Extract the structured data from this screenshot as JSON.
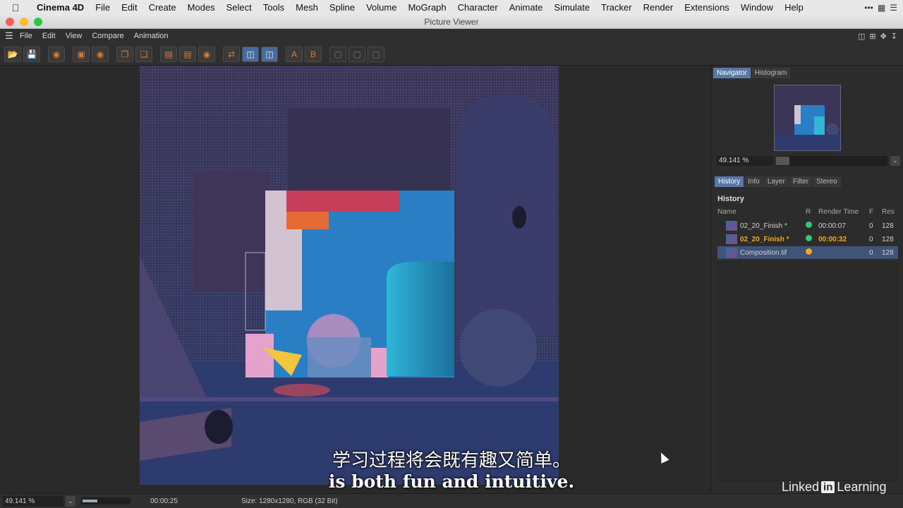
{
  "mac_menu": {
    "app": "Cinema 4D",
    "items": [
      "File",
      "Edit",
      "Create",
      "Modes",
      "Select",
      "Tools",
      "Mesh",
      "Spline",
      "Volume",
      "MoGraph",
      "Character",
      "Animate",
      "Simulate",
      "Tracker",
      "Render",
      "Extensions",
      "Window",
      "Help"
    ],
    "overflow": "•••"
  },
  "window": {
    "title": "Picture Viewer"
  },
  "viewer_menu": [
    "File",
    "Edit",
    "View",
    "Compare",
    "Animation"
  ],
  "toolbar": {
    "compare_a": "A",
    "compare_b": "B"
  },
  "side": {
    "top_tabs": [
      "Navigator",
      "Histogram"
    ],
    "zoom_value": "49.141 %",
    "zoom_fraction": 0.12,
    "bottom_tabs": [
      "History",
      "Info",
      "Layer",
      "Filter",
      "Stereo"
    ],
    "history_title": "History",
    "columns": {
      "name": "Name",
      "r": "R",
      "render_time": "Render Time",
      "f": "F",
      "res": "Res"
    },
    "rows": [
      {
        "name": "02_20_Finish *",
        "dot_color": "#2ecc71",
        "time": "00:00:07",
        "f": "0",
        "res": "128",
        "highlight": false,
        "selected": false
      },
      {
        "name": "02_20_Finish *",
        "dot_color": "#2ecc71",
        "time": "00:00:32",
        "f": "0",
        "res": "128",
        "highlight": true,
        "selected": false
      },
      {
        "name": "Composition.tif",
        "dot_color": "#f5a623",
        "time": "",
        "f": "0",
        "res": "128",
        "highlight": false,
        "selected": true
      }
    ]
  },
  "status": {
    "zoom_value": "49.141 %",
    "time": "00:00:25",
    "size_info": "Size: 1280x1280, RGB (32 Bit)",
    "progress_fraction": 0.3
  },
  "subtitles": {
    "line1": "学习过程将会既有趣又简单。",
    "line2": "is both fun and intuitive."
  },
  "brand": {
    "pre": "Linked",
    "in": "in",
    "post": "Learning"
  },
  "colors": {
    "accent": "#5878a8",
    "highlight_text": "#f5a623"
  }
}
